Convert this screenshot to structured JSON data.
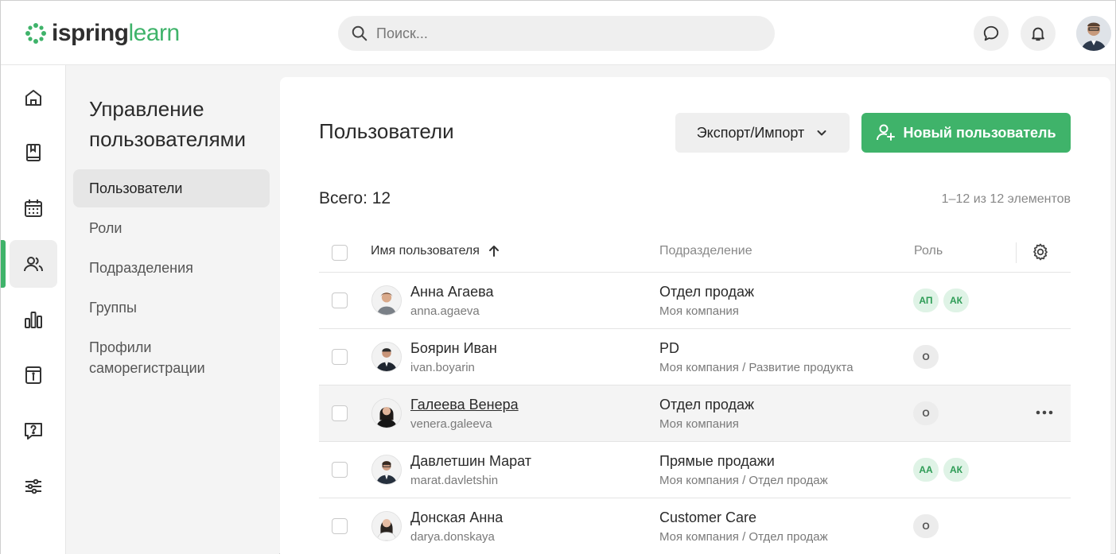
{
  "header": {
    "logo_part1": "ispring",
    "logo_part2": "learn",
    "search_placeholder": "Поиск..."
  },
  "colors": {
    "brand": "#3fb36a",
    "badge_green_bg": "#dff3e6",
    "badge_green_text": "#2e9c56"
  },
  "rail": {
    "icons": [
      "home-icon",
      "book-icon",
      "calendar-icon",
      "users-icon",
      "chart-icon",
      "info-icon",
      "help-icon",
      "settings-sliders-icon"
    ],
    "active": "users-icon"
  },
  "section": {
    "title": "Управление пользователями",
    "items": [
      {
        "label": "Пользователи",
        "active": true
      },
      {
        "label": "Роли"
      },
      {
        "label": "Подразделения"
      },
      {
        "label": "Группы"
      },
      {
        "label": "Профили саморегистрации"
      }
    ]
  },
  "main": {
    "title": "Пользователи",
    "export_label": "Экспорт/Импорт",
    "new_user_label": "Новый пользователь",
    "total": "Всего: 12",
    "pager": "1–12 из 12 элементов",
    "columns": {
      "name": "Имя пользователя",
      "dept": "Подразделение",
      "role": "Роль"
    },
    "rows": [
      {
        "name": "Анна Агаева",
        "login": "anna.agaeva",
        "dept": "Отдел продаж",
        "path": "Моя компания",
        "badges": [
          "АП",
          "АК"
        ],
        "badge_color": "green"
      },
      {
        "name": "Боярин Иван",
        "login": "ivan.boyarin",
        "dept": "PD",
        "path": "Моя компания / Развитие продукта",
        "badges": [
          "О"
        ],
        "badge_color": "gray"
      },
      {
        "name": "Галеева Венера",
        "login": "venera.galeeva",
        "dept": "Отдел продаж",
        "path": "Моя компания",
        "badges": [
          "О"
        ],
        "badge_color": "gray",
        "hover": true
      },
      {
        "name": "Давлетшин Марат",
        "login": "marat.davletshin",
        "dept": "Прямые продажи",
        "path": "Моя компания / Отдел продаж",
        "badges": [
          "АА",
          "АК"
        ],
        "badge_color": "green"
      },
      {
        "name": "Донская Анна",
        "login": "darya.donskaya",
        "dept": "Customer Care",
        "path": "Моя компания / Отдел продаж",
        "badges": [
          "О"
        ],
        "badge_color": "gray"
      }
    ]
  }
}
